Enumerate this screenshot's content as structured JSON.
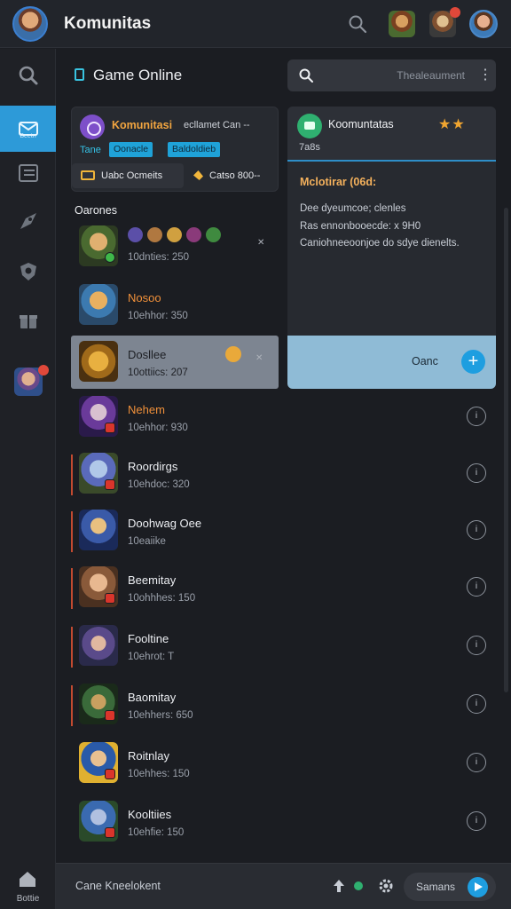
{
  "header": {
    "title": "Komunitas"
  },
  "rail": {
    "active_label": "Beetn",
    "bottom_label": "Bottie"
  },
  "section": {
    "title": "Game Online",
    "search_placeholder": "Thealeaument"
  },
  "community": {
    "title": "Komunitasi",
    "subtitle": "ecllamet Can --",
    "meta": "Tane",
    "chip1": "Oonacle",
    "chip2": "Baldoldieb",
    "btn1": "Uabc Ocmeits",
    "btn2": "Catso 800--"
  },
  "list_label": "Oarones",
  "games": [
    {
      "name": "",
      "meta": "10dnties: 250",
      "style": "normal"
    },
    {
      "name": "Nosoo",
      "meta": "10ehhor: 350",
      "style": "orange"
    },
    {
      "name": "Dosllee",
      "meta": "10ottiics: 207",
      "style": "selected"
    },
    {
      "name": "Nehem",
      "meta": "10ehhor: 930",
      "style": "orange"
    },
    {
      "name": "Roordirgs",
      "meta": "10ehdoc: 320",
      "style": "normal"
    },
    {
      "name": "Doohwag Oee",
      "meta": "10eaiike",
      "style": "normal"
    },
    {
      "name": "Beemitay",
      "meta": "10ohhhes: 150",
      "style": "normal"
    },
    {
      "name": "Fooltine",
      "meta": "10ehrot: T",
      "style": "normal"
    },
    {
      "name": "Baomitay",
      "meta": "10ehhers: 650",
      "style": "normal"
    },
    {
      "name": "Roitnlay",
      "meta": "10ehhes: 150",
      "style": "normal"
    },
    {
      "name": "Kooltiies",
      "meta": "10ehfie: 150",
      "style": "normal"
    }
  ],
  "detail": {
    "title": "Koomuntatas",
    "meta": "7a8s",
    "heading": "Mclotirar (06d:",
    "line1": "Dee dyeumcoe; clenles",
    "line2": "Ras ennonbooecde:  x  9H0",
    "line3": "Caniohneeoonjoe do sdye dienelts.",
    "cta_label": "Oanc",
    "stars": "★★"
  },
  "bottom": {
    "text": "Cane Kneelokent",
    "pill_label": "Samans"
  },
  "icons": [
    "search-icon",
    "mail-icon",
    "list-icon",
    "rocket-icon",
    "shield-icon",
    "gift-icon",
    "home-icon",
    "gear-icon",
    "play-icon",
    "info-icon",
    "plus-icon"
  ]
}
